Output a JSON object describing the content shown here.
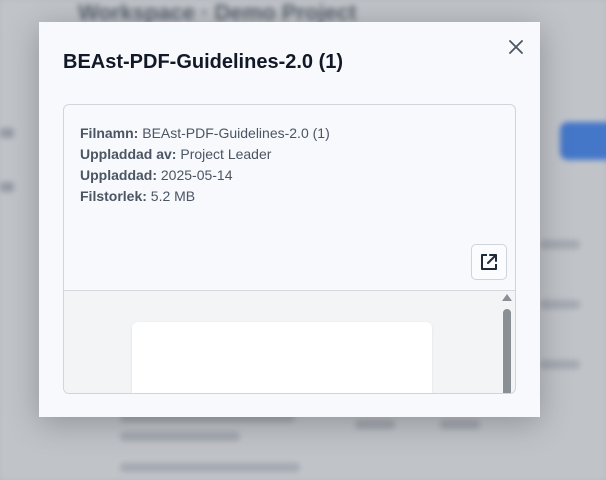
{
  "background": {
    "title": "Workspace · Demo Project"
  },
  "modal": {
    "title": "BEAst-PDF-Guidelines-2.0 (1)",
    "close_icon": "close-icon",
    "open_external_icon": "external-link-icon",
    "file_info": [
      {
        "label": "Filnamn:",
        "value": "BEAst-PDF-Guidelines-2.0 (1)"
      },
      {
        "label": "Uppladdad av:",
        "value": "Project Leader"
      },
      {
        "label": "Uppladdad:",
        "value": "2025-05-14"
      },
      {
        "label": "Filstorlek:",
        "value": "5.2 MB"
      }
    ]
  },
  "colors": {
    "accent": "#3b82f6",
    "modal_bg": "#f7f9fc",
    "text": "#111827"
  }
}
